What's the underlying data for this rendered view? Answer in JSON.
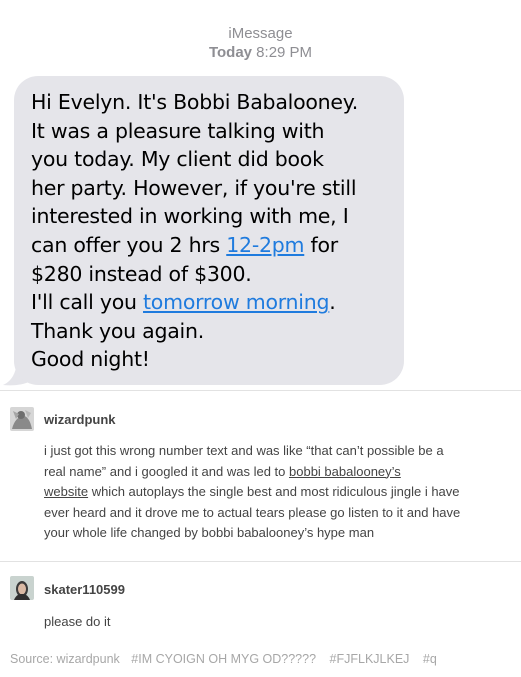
{
  "imessage": {
    "service": "iMessage",
    "day": "Today",
    "time": " 8:29 PM",
    "message": {
      "l1": "Hi Evelyn. It's Bobbi Babalooney.",
      "l2": "It was a pleasure talking with",
      "l3": "you today. My client did book",
      "l4": "her party. However, if you're still",
      "l5": "interested in working with me, I",
      "l6_before": "can offer you 2 hrs ",
      "l6_link": "12-2pm",
      "l6_after": " for",
      "l7": "$280 instead of $300.",
      "l8_before": "I'll call you ",
      "l8_link": "tomorrow morning",
      "l8_after": ".",
      "l9": "Thank you again.",
      "l10": "Good night!"
    }
  },
  "posts": [
    {
      "username": "wizardpunk",
      "l1": "i just got this wrong number text and was like “that can’t possible be a",
      "l2_before": "real name” and i googled it and was led to ",
      "l2_link": "bobbi babalooney’s",
      "l3_link": "website",
      "l3_after": " which autoplays the single best and most ridiculous jingle i have",
      "l4": "ever heard and it drove me to actual tears please go listen to it and have",
      "l5": "your whole life changed by bobbi babalooney’s hype man"
    },
    {
      "username": "skater110599",
      "text": "please do it"
    }
  ],
  "footer": {
    "source": "Source: wizardpunk",
    "tags": [
      "#IM CYOIGN OH MYG OD?????",
      "#FJFLKJLKEJ",
      "#q"
    ]
  },
  "colors": {
    "bubble": "#e5e5ea",
    "link": "#1f7bde",
    "text": "#444444",
    "muted": "#a7a7a7"
  }
}
